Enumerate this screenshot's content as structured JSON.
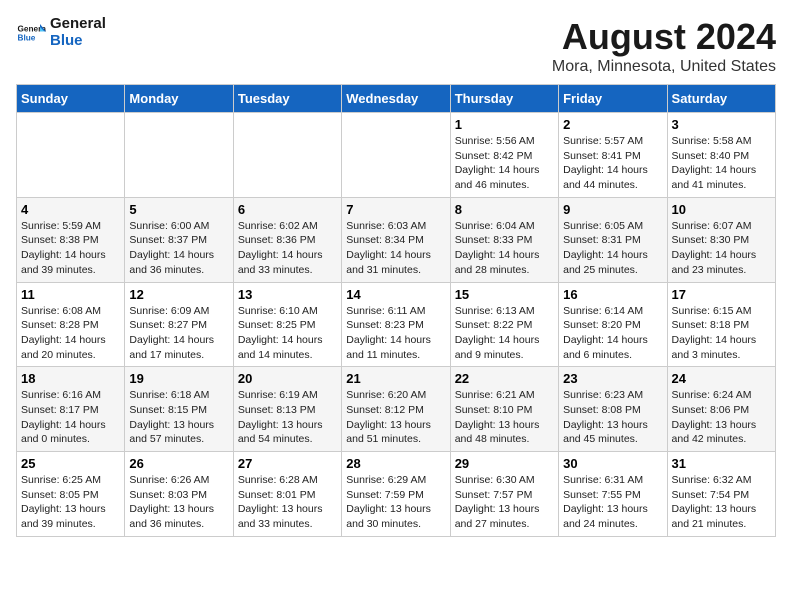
{
  "logo": {
    "text_general": "General",
    "text_blue": "Blue"
  },
  "title": "August 2024",
  "subtitle": "Mora, Minnesota, United States",
  "days_of_week": [
    "Sunday",
    "Monday",
    "Tuesday",
    "Wednesday",
    "Thursday",
    "Friday",
    "Saturday"
  ],
  "weeks": [
    [
      {
        "day": "",
        "info": ""
      },
      {
        "day": "",
        "info": ""
      },
      {
        "day": "",
        "info": ""
      },
      {
        "day": "",
        "info": ""
      },
      {
        "day": "1",
        "info": "Sunrise: 5:56 AM\nSunset: 8:42 PM\nDaylight: 14 hours\nand 46 minutes."
      },
      {
        "day": "2",
        "info": "Sunrise: 5:57 AM\nSunset: 8:41 PM\nDaylight: 14 hours\nand 44 minutes."
      },
      {
        "day": "3",
        "info": "Sunrise: 5:58 AM\nSunset: 8:40 PM\nDaylight: 14 hours\nand 41 minutes."
      }
    ],
    [
      {
        "day": "4",
        "info": "Sunrise: 5:59 AM\nSunset: 8:38 PM\nDaylight: 14 hours\nand 39 minutes."
      },
      {
        "day": "5",
        "info": "Sunrise: 6:00 AM\nSunset: 8:37 PM\nDaylight: 14 hours\nand 36 minutes."
      },
      {
        "day": "6",
        "info": "Sunrise: 6:02 AM\nSunset: 8:36 PM\nDaylight: 14 hours\nand 33 minutes."
      },
      {
        "day": "7",
        "info": "Sunrise: 6:03 AM\nSunset: 8:34 PM\nDaylight: 14 hours\nand 31 minutes."
      },
      {
        "day": "8",
        "info": "Sunrise: 6:04 AM\nSunset: 8:33 PM\nDaylight: 14 hours\nand 28 minutes."
      },
      {
        "day": "9",
        "info": "Sunrise: 6:05 AM\nSunset: 8:31 PM\nDaylight: 14 hours\nand 25 minutes."
      },
      {
        "day": "10",
        "info": "Sunrise: 6:07 AM\nSunset: 8:30 PM\nDaylight: 14 hours\nand 23 minutes."
      }
    ],
    [
      {
        "day": "11",
        "info": "Sunrise: 6:08 AM\nSunset: 8:28 PM\nDaylight: 14 hours\nand 20 minutes."
      },
      {
        "day": "12",
        "info": "Sunrise: 6:09 AM\nSunset: 8:27 PM\nDaylight: 14 hours\nand 17 minutes."
      },
      {
        "day": "13",
        "info": "Sunrise: 6:10 AM\nSunset: 8:25 PM\nDaylight: 14 hours\nand 14 minutes."
      },
      {
        "day": "14",
        "info": "Sunrise: 6:11 AM\nSunset: 8:23 PM\nDaylight: 14 hours\nand 11 minutes."
      },
      {
        "day": "15",
        "info": "Sunrise: 6:13 AM\nSunset: 8:22 PM\nDaylight: 14 hours\nand 9 minutes."
      },
      {
        "day": "16",
        "info": "Sunrise: 6:14 AM\nSunset: 8:20 PM\nDaylight: 14 hours\nand 6 minutes."
      },
      {
        "day": "17",
        "info": "Sunrise: 6:15 AM\nSunset: 8:18 PM\nDaylight: 14 hours\nand 3 minutes."
      }
    ],
    [
      {
        "day": "18",
        "info": "Sunrise: 6:16 AM\nSunset: 8:17 PM\nDaylight: 14 hours\nand 0 minutes."
      },
      {
        "day": "19",
        "info": "Sunrise: 6:18 AM\nSunset: 8:15 PM\nDaylight: 13 hours\nand 57 minutes."
      },
      {
        "day": "20",
        "info": "Sunrise: 6:19 AM\nSunset: 8:13 PM\nDaylight: 13 hours\nand 54 minutes."
      },
      {
        "day": "21",
        "info": "Sunrise: 6:20 AM\nSunset: 8:12 PM\nDaylight: 13 hours\nand 51 minutes."
      },
      {
        "day": "22",
        "info": "Sunrise: 6:21 AM\nSunset: 8:10 PM\nDaylight: 13 hours\nand 48 minutes."
      },
      {
        "day": "23",
        "info": "Sunrise: 6:23 AM\nSunset: 8:08 PM\nDaylight: 13 hours\nand 45 minutes."
      },
      {
        "day": "24",
        "info": "Sunrise: 6:24 AM\nSunset: 8:06 PM\nDaylight: 13 hours\nand 42 minutes."
      }
    ],
    [
      {
        "day": "25",
        "info": "Sunrise: 6:25 AM\nSunset: 8:05 PM\nDaylight: 13 hours\nand 39 minutes."
      },
      {
        "day": "26",
        "info": "Sunrise: 6:26 AM\nSunset: 8:03 PM\nDaylight: 13 hours\nand 36 minutes."
      },
      {
        "day": "27",
        "info": "Sunrise: 6:28 AM\nSunset: 8:01 PM\nDaylight: 13 hours\nand 33 minutes."
      },
      {
        "day": "28",
        "info": "Sunrise: 6:29 AM\nSunset: 7:59 PM\nDaylight: 13 hours\nand 30 minutes."
      },
      {
        "day": "29",
        "info": "Sunrise: 6:30 AM\nSunset: 7:57 PM\nDaylight: 13 hours\nand 27 minutes."
      },
      {
        "day": "30",
        "info": "Sunrise: 6:31 AM\nSunset: 7:55 PM\nDaylight: 13 hours\nand 24 minutes."
      },
      {
        "day": "31",
        "info": "Sunrise: 6:32 AM\nSunset: 7:54 PM\nDaylight: 13 hours\nand 21 minutes."
      }
    ]
  ]
}
